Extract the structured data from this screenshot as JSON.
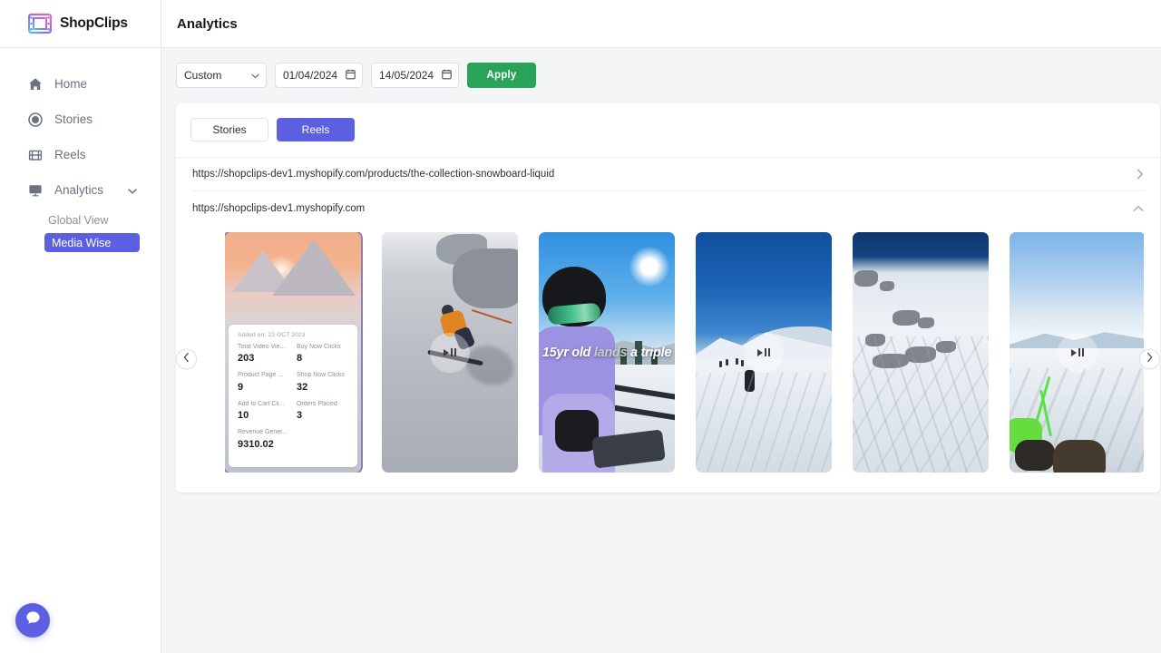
{
  "brand": {
    "name": "ShopClips",
    "logo_icon": "film-strip-icon",
    "accent": "#5d5fe3"
  },
  "sidebar": {
    "items": [
      {
        "label": "Home",
        "icon": "home-icon"
      },
      {
        "label": "Stories",
        "icon": "circle-record-icon"
      },
      {
        "label": "Reels",
        "icon": "film-clapper-icon"
      },
      {
        "label": "Analytics",
        "icon": "presentation-chart-icon",
        "chevron": "chevron-down-icon",
        "expanded": true
      }
    ],
    "subitems": [
      {
        "label": "Global View",
        "active": false
      },
      {
        "label": "Media Wise",
        "active": true
      }
    ],
    "chat_widget": {
      "icon": "chat-bubble-icon",
      "color": "#5d5fe3"
    }
  },
  "header": {
    "title": "Analytics"
  },
  "filters": {
    "range_select": {
      "value": "Custom",
      "chevron": "chevron-down-icon"
    },
    "start_date": {
      "value": "01/04/2024",
      "icon": "calendar-icon"
    },
    "end_date": {
      "value": "14/05/2024",
      "icon": "calendar-icon"
    },
    "apply_label": "Apply",
    "apply_color": "#2aa35a"
  },
  "tabs": [
    {
      "label": "Stories",
      "active": false
    },
    {
      "label": "Reels",
      "active": true
    }
  ],
  "url_rows": [
    {
      "url": "https://shopclips-dev1.myshopify.com/products/the-collection-snowboard-liquid",
      "chevron": "chevron-right-icon",
      "expanded": false
    },
    {
      "url": "https://shopclips-dev1.myshopify.com",
      "chevron": "chevron-up-icon",
      "expanded": true
    }
  ],
  "carousel": {
    "prev_icon": "chevron-left-icon",
    "next_icon": "chevron-right-icon",
    "play_icon": "play-pause-icon",
    "thumbnails": [
      {
        "scene": "sunset-mountain-peaks",
        "selected": true,
        "has_play": false,
        "caption": ""
      },
      {
        "scene": "skier-orange-jacket",
        "selected": false,
        "has_play": true,
        "caption": ""
      },
      {
        "scene": "pov-skier-blue-sky",
        "selected": false,
        "has_play": false,
        "caption_pre": "15yr old ",
        "caption_em": "lands",
        "caption_post": " a triple"
      },
      {
        "scene": "deep-blue-sky-slope",
        "selected": false,
        "has_play": true,
        "caption": ""
      },
      {
        "scene": "snowy-rocky-face",
        "selected": false,
        "has_play": false,
        "caption": ""
      },
      {
        "scene": "pov-snow-descent",
        "selected": false,
        "has_play": true,
        "caption": ""
      }
    ]
  },
  "stat_card": {
    "added_on": "Added on: 23 OCT 2023",
    "stats": [
      {
        "label": "Total Video Vie...",
        "value": "203"
      },
      {
        "label": "Buy Now Clicks",
        "value": "8"
      },
      {
        "label": "Product Page ...",
        "value": "9"
      },
      {
        "label": "Shop Now Clicks",
        "value": "32"
      },
      {
        "label": "Add to Cart Cli...",
        "value": "10"
      },
      {
        "label": "Orders Placed",
        "value": "3"
      }
    ],
    "revenue": {
      "label": "Revenue Gener...",
      "value": "9310.02"
    }
  }
}
